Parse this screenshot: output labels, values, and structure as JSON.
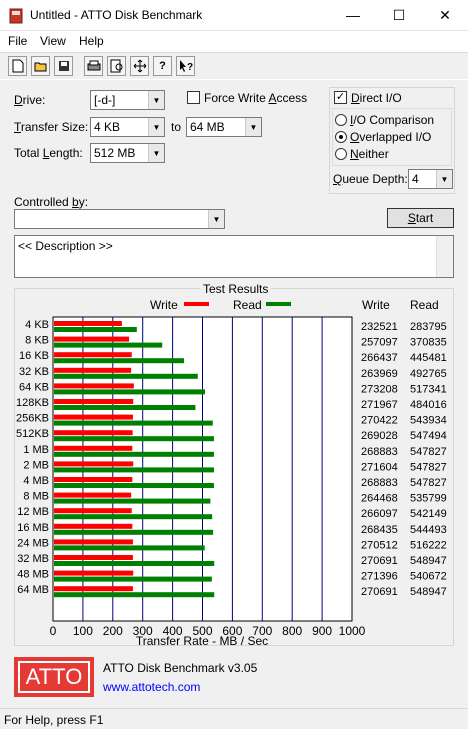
{
  "window": {
    "title": "Untitled - ATTO Disk Benchmark",
    "minimize": "—",
    "maximize": "☐",
    "close": "✕"
  },
  "menu": {
    "file": "File",
    "view": "View",
    "help": "Help"
  },
  "form": {
    "drive_label": "Drive:",
    "drive_value": "[-d-]",
    "transfer_label": "Transfer Size:",
    "transfer_from": "4 KB",
    "to_label": "to",
    "transfer_to": "64 MB",
    "total_label": "Total Length:",
    "total_value": "512 MB",
    "force_write_label": "Force Write Access",
    "direct_io_label": "Direct I/O",
    "io_comparison_label": "I/O Comparison",
    "overlapped_label": "Overlapped I/O",
    "neither_label": "Neither",
    "queue_label": "Queue Depth:",
    "queue_value": "4",
    "controlled_label": "Controlled by:",
    "controlled_value": "",
    "start_label": "Start",
    "description": "<< Description >>"
  },
  "results": {
    "group_title": "Test Results",
    "write_legend": "Write",
    "read_legend": "Read",
    "write_header": "Write",
    "read_header": "Read"
  },
  "chart_data": {
    "type": "bar",
    "orientation": "horizontal",
    "xlabel": "Transfer Rate - MB / Sec",
    "xlim": [
      0,
      1000
    ],
    "xticks": [
      "0",
      "100",
      "200",
      "300",
      "400",
      "500",
      "600",
      "700",
      "800",
      "900",
      "1000"
    ],
    "grid": true,
    "legend": "top",
    "categories": [
      "4 KB",
      "8 KB",
      "16 KB",
      "32 KB",
      "64 KB",
      "128KB",
      "256KB",
      "512KB",
      "1 MB",
      "2 MB",
      "4 MB",
      "8 MB",
      "12 MB",
      "16 MB",
      "24 MB",
      "32 MB",
      "48 MB",
      "64 MB"
    ],
    "series": [
      {
        "name": "Write",
        "color": "#ff0000",
        "values": [
          227,
          251,
          260,
          258,
          267,
          265,
          264,
          263,
          262,
          265,
          262,
          258,
          260,
          262,
          264,
          264,
          265,
          264
        ],
        "labels": [
          "232521",
          "257097",
          "266437",
          "263969",
          "273208",
          "271967",
          "270422",
          "269028",
          "268883",
          "271604",
          "268883",
          "264468",
          "266097",
          "268435",
          "270512",
          "270691",
          "271396",
          "270691"
        ]
      },
      {
        "name": "Read",
        "color": "#008000",
        "values": [
          277,
          362,
          435,
          481,
          505,
          473,
          531,
          535,
          535,
          535,
          535,
          523,
          529,
          532,
          504,
          536,
          528,
          536
        ],
        "labels": [
          "283795",
          "370835",
          "445481",
          "492765",
          "517341",
          "484016",
          "543934",
          "547494",
          "547827",
          "547827",
          "547827",
          "535799",
          "542149",
          "544493",
          "516222",
          "548947",
          "540672",
          "548947"
        ]
      }
    ]
  },
  "footer": {
    "logo": "ATTO",
    "product": "ATTO Disk Benchmark v3.05",
    "link": "www.attotech.com"
  },
  "status": "For Help, press F1"
}
